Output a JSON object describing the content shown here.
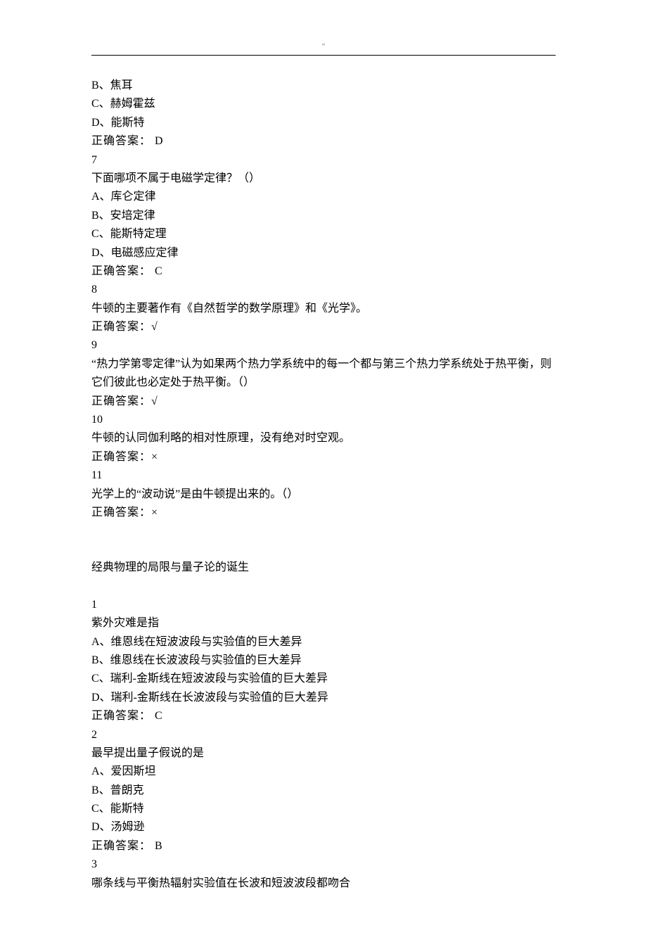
{
  "header": {
    "mark": "\""
  },
  "continuation": {
    "optB": "B、焦耳",
    "optC": "C、赫姆霍兹",
    "optD": "D、能斯特",
    "answer": "正确答案： D"
  },
  "q7": {
    "num": "7",
    "stem": "下面哪项不属于电磁学定律？（）",
    "optA": "A、库仑定律",
    "optB": "B、安培定律",
    "optC": "C、能斯特定理",
    "optD": "D、电磁感应定律",
    "answer": "正确答案： C"
  },
  "q8": {
    "num": "8",
    "stem": "牛顿的主要著作有《自然哲学的数学原理》和《光学》。",
    "answer": "正确答案：√"
  },
  "q9": {
    "num": "9",
    "stem": "“热力学第零定律”认为如果两个热力学系统中的每一个都与第三个热力学系统处于热平衡，则它们彼此也必定处于热平衡。（）",
    "answer": "正确答案：√"
  },
  "q10": {
    "num": "10",
    "stem": "牛顿的认同伽利略的相对性原理，没有绝对时空观。",
    "answer": "正确答案：×"
  },
  "q11": {
    "num": "11",
    "stem": "光学上的“波动说”是由牛顿提出来的。（）",
    "answer": "正确答案：×"
  },
  "section2": {
    "title": "经典物理的局限与量子论的诞生"
  },
  "s2q1": {
    "num": "1",
    "stem": "紫外灾难是指",
    "optA": "A、维恩线在短波波段与实验值的巨大差异",
    "optB": "B、维恩线在长波波段与实验值的巨大差异",
    "optC": "C、瑞利-金斯线在短波波段与实验值的巨大差异",
    "optD": "D、瑞利-金斯线在长波波段与实验值的巨大差异",
    "answer": "正确答案： C"
  },
  "s2q2": {
    "num": "2",
    "stem": "最早提出量子假说的是",
    "optA": "A、爱因斯坦",
    "optB": "B、普朗克",
    "optC": "C、能斯特",
    "optD": "D、汤姆逊",
    "answer": "正确答案： B"
  },
  "s2q3": {
    "num": "3",
    "stem": "哪条线与平衡热辐射实验值在长波和短波波段都吻合"
  }
}
